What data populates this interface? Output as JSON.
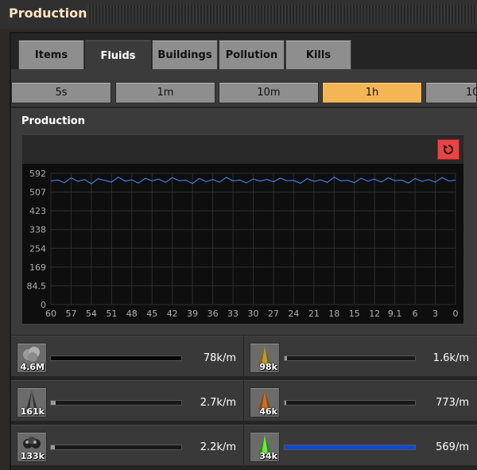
{
  "window": {
    "title": "Production"
  },
  "tabs": [
    {
      "label": "Items",
      "active": false
    },
    {
      "label": "Fluids",
      "active": true
    },
    {
      "label": "Buildings",
      "active": false
    },
    {
      "label": "Pollution",
      "active": false
    },
    {
      "label": "Kills",
      "active": false
    }
  ],
  "time_buttons": [
    {
      "label": "5s",
      "active": false
    },
    {
      "label": "1m",
      "active": false
    },
    {
      "label": "10m",
      "active": false
    },
    {
      "label": "1h",
      "active": true
    },
    {
      "label": "10",
      "active": false
    }
  ],
  "graph": {
    "heading": "Production",
    "reset_icon": "reset-icon"
  },
  "chart_data": {
    "type": "line",
    "title": "",
    "y_ticks": [
      "592",
      "507",
      "423",
      "338",
      "254",
      "169",
      "84.5",
      "0"
    ],
    "x_ticks": [
      "60",
      "57",
      "54",
      "51",
      "48",
      "45",
      "42",
      "39",
      "36",
      "33",
      "30",
      "27",
      "24",
      "21",
      "18",
      "15",
      "12",
      "9.1",
      "6",
      "3",
      "0"
    ],
    "ylim": [
      0,
      592
    ],
    "xlim": [
      60,
      0
    ],
    "grid": true,
    "series_color": "#4d8fff",
    "series": [
      {
        "values": [
          558,
          562,
          550,
          572,
          556,
          564,
          545,
          568,
          560,
          553,
          575,
          557,
          563,
          548,
          570,
          558,
          566,
          551,
          573,
          559,
          561,
          546,
          569,
          555,
          564,
          552,
          574,
          558,
          562,
          549,
          567,
          557,
          565,
          554,
          571,
          559,
          560,
          547,
          568,
          556,
          563,
          551,
          575,
          558,
          561,
          550,
          570,
          557,
          566,
          553,
          572,
          559,
          562,
          548,
          569,
          556,
          564,
          552,
          573,
          558,
          561
        ]
      }
    ]
  },
  "list": {
    "items": [
      {
        "icon": "steam-icon",
        "count": "4.6M",
        "rate": "78k/m",
        "fill": 1.0,
        "fill_color": "#050505"
      },
      {
        "icon": "crude-oil-icon",
        "count": "98k",
        "rate": "1.6k/m",
        "fill": 0.02,
        "fill_color": "#9a9a9a"
      },
      {
        "icon": "petroleum-gas-icon",
        "count": "161k",
        "rate": "2.7k/m",
        "fill": 0.035,
        "fill_color": "#9a9a9a"
      },
      {
        "icon": "heavy-oil-icon",
        "count": "46k",
        "rate": "773/m",
        "fill": 0.01,
        "fill_color": "#9a9a9a"
      },
      {
        "icon": "water-icon",
        "count": "133k",
        "rate": "2.2k/m",
        "fill": 0.03,
        "fill_color": "#9a9a9a"
      },
      {
        "icon": "sulfuric-acid-icon",
        "count": "34k",
        "rate": "569/m",
        "fill": 1.0,
        "fill_color": "#0a4bd6"
      }
    ]
  }
}
